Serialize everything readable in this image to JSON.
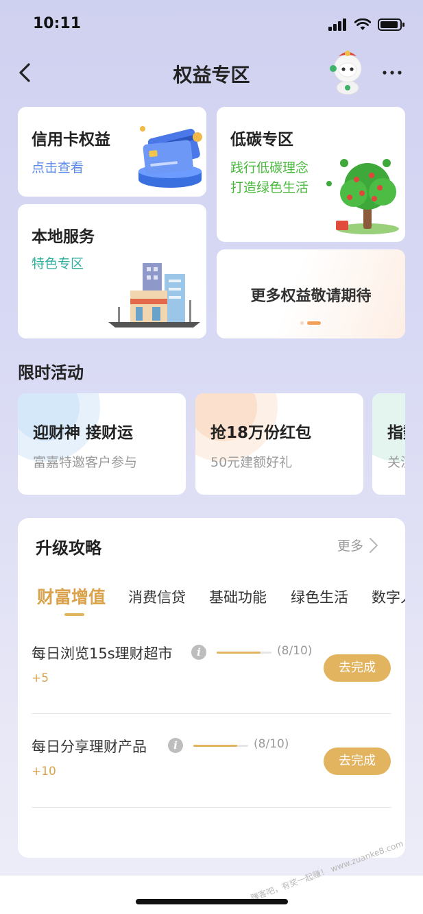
{
  "status_bar": {
    "time": "10:11"
  },
  "nav": {
    "title": "权益专区"
  },
  "cards": {
    "credit": {
      "title": "信用卡权益",
      "sub": "点击查看"
    },
    "lowcarbon": {
      "title": "低碳专区",
      "line1": "践行低碳理念",
      "line2": "打造绿色生活"
    },
    "local": {
      "title": "本地服务",
      "sub": "特色专区"
    },
    "more": {
      "title": "更多权益敬请期待"
    }
  },
  "limited": {
    "heading": "限时活动",
    "items": [
      {
        "title": "迎财神 接财运",
        "sub": "富嘉特邀客户参与"
      },
      {
        "title": "抢18万份红包",
        "sub": "50元建额好礼"
      },
      {
        "title": "指数",
        "sub": "关注"
      }
    ]
  },
  "upgrade": {
    "heading": "升级攻略",
    "more": "更多",
    "tabs": [
      "财富增值",
      "消费信贷",
      "基础功能",
      "绿色生活",
      "数字人"
    ],
    "tasks": [
      {
        "name": "每日浏览15s理财超市",
        "points": "+5",
        "progress_text": "(8/10)",
        "progress": 0.8,
        "button": "去完成"
      },
      {
        "name": "每日分享理财产品",
        "points": "+10",
        "progress_text": "(8/10)",
        "progress": 0.8,
        "button": "去完成"
      }
    ]
  },
  "watermark": "赚客吧，有奖一起赚！ www.zuanke8.com",
  "colors": {
    "accent": "#e3b45f",
    "blue": "#5b8be6",
    "green": "#46b83a",
    "teal": "#2fae9c"
  }
}
